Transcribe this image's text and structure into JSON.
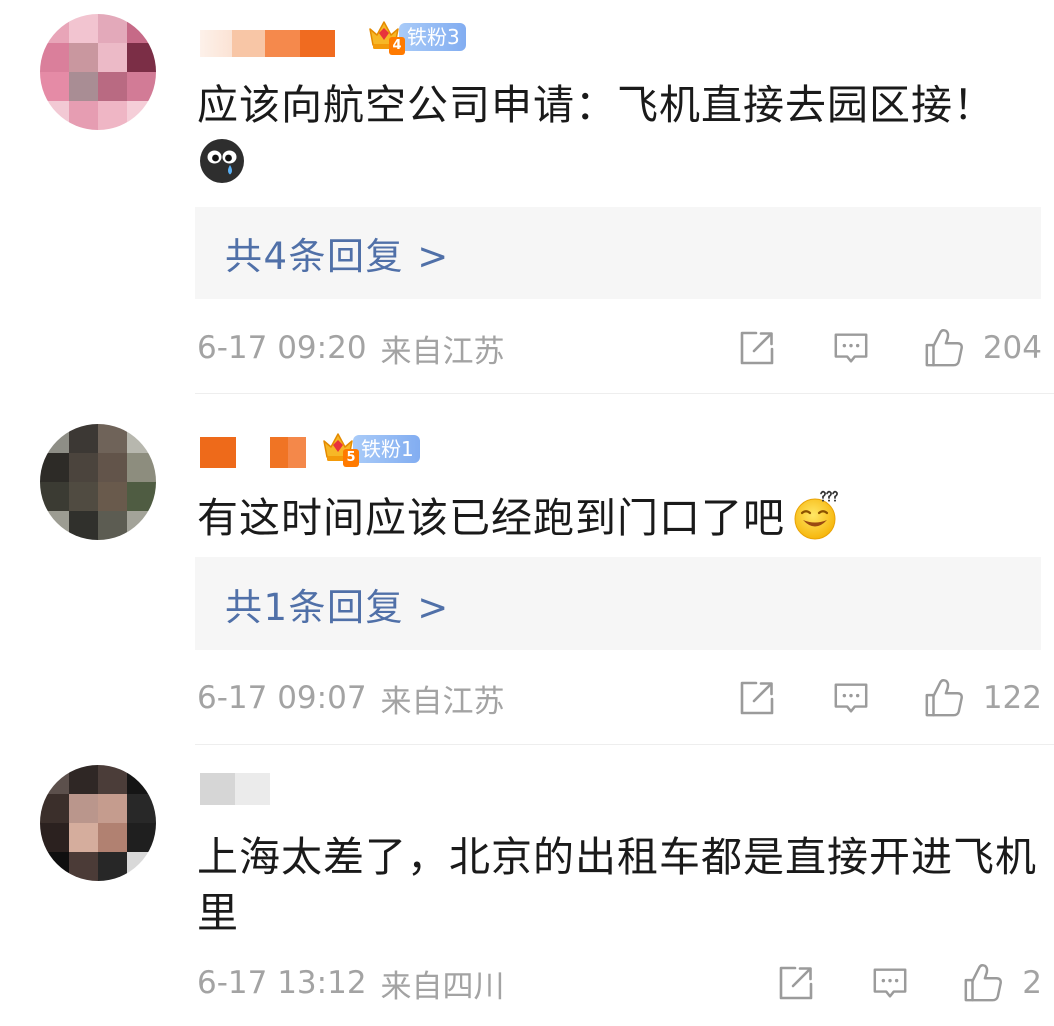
{
  "comments": [
    {
      "badge": {
        "level": "4",
        "label": "铁粉3"
      },
      "text": "应该向航空公司申请：飞机直接去园区接！",
      "emoji_icon": "bitter-face-emoji-icon",
      "replies_label": "共4条回复 >",
      "time": "6-17 09:20",
      "source": "来自江苏",
      "likes": 204
    },
    {
      "badge": {
        "level": "5",
        "label": "铁粉1"
      },
      "text": "有这时间应该已经跑到门口了吧",
      "emoji_icon": "puzzled-face-emoji-icon",
      "replies_label": "共1条回复 >",
      "time": "6-17 09:07",
      "source": "来自江苏",
      "likes": 122
    },
    {
      "text": "上海太差了，北京的出租车都是直接开进飞机里",
      "time": "6-17 13:12",
      "source": "来自四川",
      "likes": 2
    }
  ],
  "icons": {
    "share": "share-icon",
    "comment": "comment-icon",
    "like": "thumbs-up-icon",
    "badge": "crown-icon"
  },
  "colors": {
    "comment_text": "#1a1a1a",
    "meta_text": "#a3a3a3",
    "reply_link": "#5070a8",
    "reply_background": "#f6f6f6",
    "badge_background": "#82adf1",
    "badge_level": "#ff7a00",
    "icon_stroke": "#9b9b9b"
  }
}
